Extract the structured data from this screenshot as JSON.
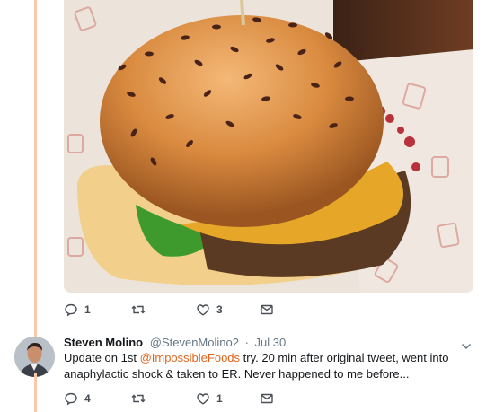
{
  "theme": {
    "accent": "#e0661f",
    "thread_line": "#f9c9a8",
    "muted": "#657786"
  },
  "media": {
    "description_icon": "burger-photo"
  },
  "first_actions": {
    "reply_count": "1",
    "retweet_count": "",
    "like_count": "3"
  },
  "tweet": {
    "author_name": "Steven Molino",
    "author_handle": "@StevenMolino2",
    "separator": "·",
    "date": "Jul 30",
    "text_before": "Update on 1st ",
    "mention": "@ImpossibleFoods",
    "text_after": " try. 20 min after original tweet, went into anaphylactic shock & taken to ER. Never happened to me before...",
    "reply_count": "4",
    "retweet_count": "",
    "like_count": "1"
  },
  "icons": [
    "reply-icon",
    "retweet-icon",
    "like-icon",
    "message-icon",
    "chevron-down-icon"
  ]
}
